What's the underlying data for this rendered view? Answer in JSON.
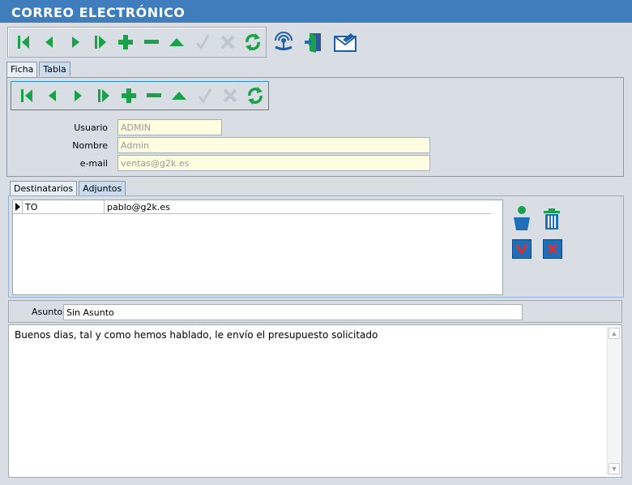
{
  "window": {
    "title": "CORREO ELECTRÓNICO"
  },
  "colors": {
    "titlebar": "#3f7dbd",
    "nav_green": "#1aa24a",
    "accent_blue": "#1e6fb8",
    "field_bg": "#fdfde0"
  },
  "main_toolbar": {
    "buttons": [
      "first-record-icon",
      "prev-record-icon",
      "next-record-icon",
      "last-record-icon",
      "add-icon",
      "delete-icon",
      "edit-icon",
      "confirm-icon",
      "cancel-icon",
      "refresh-icon"
    ],
    "extra_buttons": [
      "broadcast-icon",
      "exit-door-icon",
      "email-send-icon"
    ]
  },
  "top_tabs": [
    {
      "label": "Ficha",
      "active": true
    },
    {
      "label": "Tabla",
      "active": false
    }
  ],
  "form": {
    "usuario": {
      "label": "Usuario",
      "value": "ADMIN"
    },
    "nombre": {
      "label": "Nombre",
      "value": "Admin"
    },
    "email": {
      "label": "e-mail",
      "value": "ventas@g2k.es"
    }
  },
  "mid_tabs": [
    {
      "label": "Destinatarios",
      "active": true
    },
    {
      "label": "Adjuntos",
      "active": false
    }
  ],
  "recipients": [
    {
      "type": "TO",
      "address": "pablo@g2k.es"
    }
  ],
  "side_buttons": [
    "add-person-icon",
    "trash-icon",
    "accept-v-icon",
    "reject-x-icon"
  ],
  "asunto": {
    "label": "Asunto",
    "value": "Sin Asunto"
  },
  "body": {
    "text": "Buenos dias, tal y como hemos hablado, le envío el presupuesto solicitado"
  }
}
